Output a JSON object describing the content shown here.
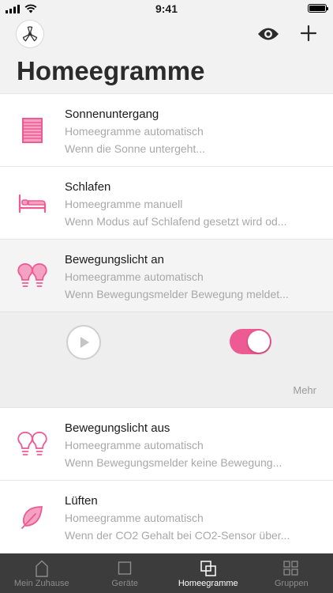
{
  "status": {
    "time": "9:41"
  },
  "header": {
    "title": "Homeegramme"
  },
  "colors": {
    "accent": "#ee5b93",
    "tabbar": "#3c3c3c"
  },
  "items": [
    {
      "icon": "blinds-icon",
      "title": "Sonnenuntergang",
      "subtitle": "Homeegramme automatisch",
      "description": "Wenn die Sonne untergeht..."
    },
    {
      "icon": "bed-icon",
      "title": "Schlafen",
      "subtitle": "Homeegramme manuell",
      "description": "Wenn Modus auf Schlafend gesetzt wird od..."
    },
    {
      "icon": "bulbs-on-icon",
      "title": "Bewegungslicht an",
      "subtitle": "Homeegramme automatisch",
      "description": "Wenn Bewegungsmelder Bewegung meldet..."
    },
    {
      "icon": "bulbs-off-icon",
      "title": "Bewegungslicht aus",
      "subtitle": "Homeegramme automatisch",
      "description": "Wenn Bewegungsmelder keine Bewegung..."
    },
    {
      "icon": "leaf-icon",
      "title": "Lüften",
      "subtitle": "Homeegramme automatisch",
      "description": "Wenn der CO2 Gehalt bei CO2-Sensor über..."
    }
  ],
  "expanded": {
    "more_label": "Mehr",
    "toggle_on": true
  },
  "tabs": [
    {
      "icon": "home-icon",
      "label": "Mein Zuhause"
    },
    {
      "icon": "device-icon",
      "label": "Geräte"
    },
    {
      "icon": "homeegram-icon",
      "label": "Homeegramme",
      "active": true
    },
    {
      "icon": "groups-icon",
      "label": "Gruppen"
    }
  ]
}
